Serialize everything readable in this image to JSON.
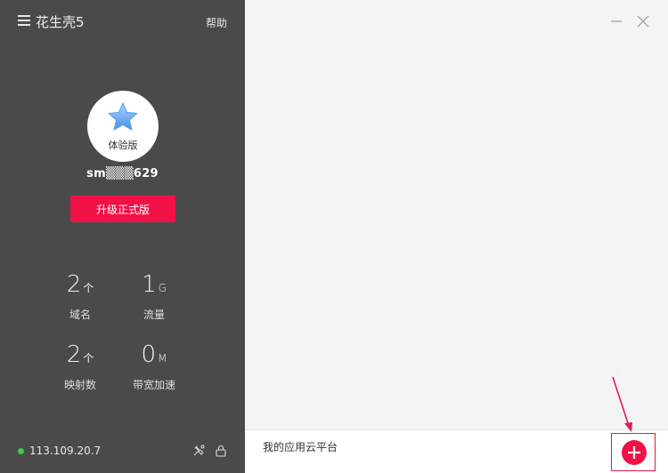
{
  "header": {
    "app_title": "花生壳5",
    "help_label": "帮助"
  },
  "account": {
    "edition": "体验版",
    "username": "sm▒▒▒629",
    "upgrade_label": "升级正式版"
  },
  "stats": {
    "domains": {
      "value": "2",
      "unit": "个",
      "label": "域名"
    },
    "traffic": {
      "value": "1",
      "unit": "G",
      "label": "流量"
    },
    "mappings": {
      "value": "2",
      "unit": "个",
      "label": "映射数"
    },
    "bandwidth": {
      "value": "0",
      "unit": "M",
      "label": "带宽加速"
    }
  },
  "footer": {
    "ip": "113.109.20.7",
    "status_color": "#3ccf4e"
  },
  "main": {
    "bottom_label": "我的应用云平台"
  },
  "colors": {
    "accent": "#f21147",
    "sidebar_bg": "#4a4a4a",
    "main_bg": "#f4f4f7"
  },
  "icons": [
    "menu-icon",
    "star-icon",
    "tools-icon",
    "lock-icon",
    "minimize-icon",
    "close-icon",
    "plus-icon"
  ]
}
